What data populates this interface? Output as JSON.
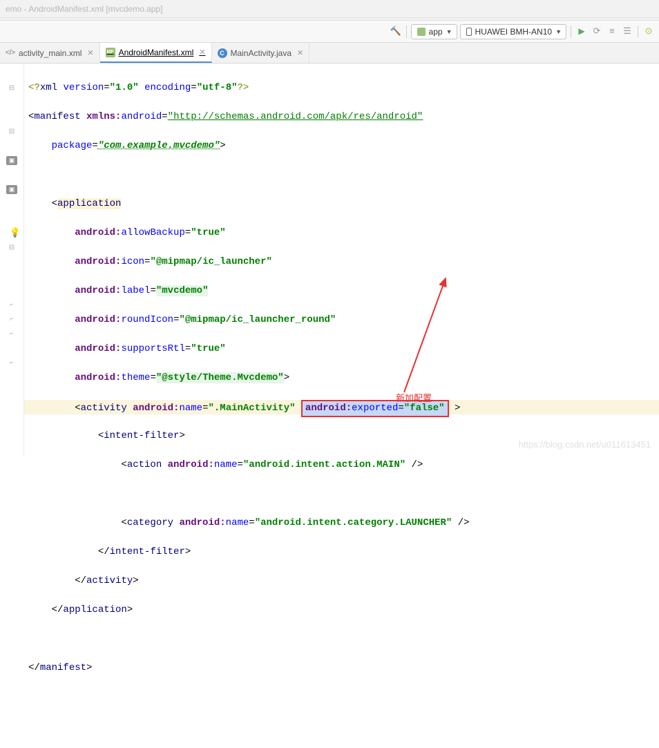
{
  "title_fragment": "emo - AndroidManifest.xml  [mvcdemo.app]",
  "toolbar": {
    "module": "app",
    "device": "HUAWEI BMH-AN10"
  },
  "tabs": [
    {
      "label": "activity_main.xml",
      "icon": "xml",
      "active": false
    },
    {
      "label": "AndroidManifest.xml",
      "icon": "mf",
      "active": true
    },
    {
      "label": "MainActivity.java",
      "icon": "java",
      "active": false
    }
  ],
  "code": {
    "xml_decl_name": "xml",
    "version_attr": "version",
    "version_val": "\"1.0\"",
    "encoding_attr": "encoding",
    "encoding_val": "\"utf-8\"",
    "manifest": "manifest",
    "xmlns": "xmlns:",
    "android_ns": "android",
    "ns_url": "\"http://schemas.android.com/apk/res/android\"",
    "package_attr": "package",
    "package_val": "\"com.example.mvcdemo\"",
    "application": "application",
    "attr_android": "android:",
    "allowBackup": "allowBackup",
    "true_val": "\"true\"",
    "icon": "icon",
    "icon_val": "\"@mipmap/ic_launcher\"",
    "label": "label",
    "label_val": "\"mvcdemo\"",
    "roundIcon": "roundIcon",
    "roundIcon_val": "\"@mipmap/ic_launcher_round\"",
    "supportsRtl": "supportsRtl",
    "theme": "theme",
    "theme_val": "\"@style/Theme.Mvcdemo\"",
    "activity": "activity",
    "name_attr": "name",
    "activity_name": "\".MainActivity\"",
    "exported": "exported",
    "false_val": "\"false\"",
    "intent_filter": "intent-filter",
    "action": "action",
    "action_val": "\"android.intent.action.MAIN\"",
    "category": "category",
    "category_val": "\"android.intent.category.LAUNCHER\""
  },
  "annotation": "新加配置",
  "watermark": "https://blog.csdn.net/u011613451"
}
